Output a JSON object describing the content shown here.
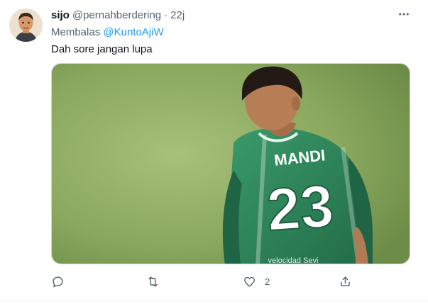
{
  "tweet": {
    "display_name": "sijo",
    "handle": "@pernahberdering",
    "separator": "·",
    "time": "22j",
    "reply_prefix": "Membalas",
    "reply_mention": "@KuntoAjiW",
    "text": "Dah sore jangan lupa"
  },
  "media": {
    "jersey_name": "MANDI",
    "jersey_number": "23",
    "jersey_sleeve_text": "velocidad Sevi"
  },
  "actions": {
    "reply_icon": "speech-bubble-icon",
    "retweet_icon": "retweet-icon",
    "like_icon": "heart-icon",
    "like_count": "2",
    "share_icon": "share-icon"
  },
  "colors": {
    "accent": "#1d9bf0",
    "secondary_text": "#536471",
    "primary_text": "#0f1419",
    "jersey_green": "#2e8b5e"
  }
}
